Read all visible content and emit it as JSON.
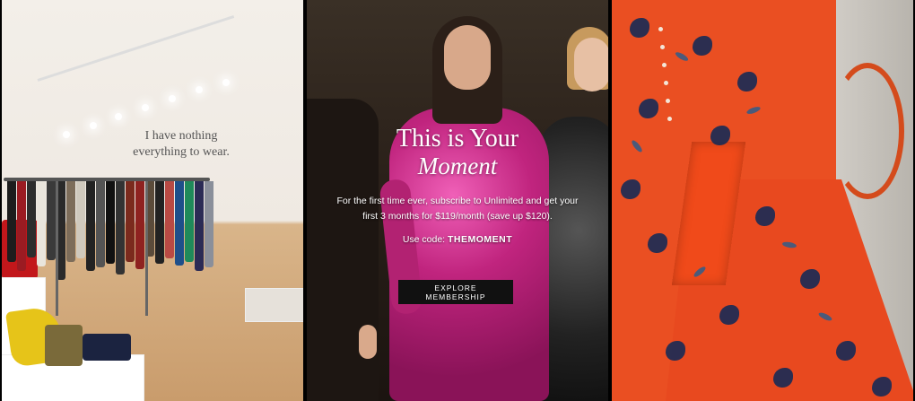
{
  "store_panel": {
    "wall_text": "I have nothing everything to wear."
  },
  "promo": {
    "title": "This is Your",
    "subtitle": "Moment",
    "body": "For the first time ever, subscribe to Unlimited and get your first 3 months for $119/month (save up $120).",
    "code_label": "Use code:",
    "code_value": "THEMOMENT",
    "cta_label": "EXPLORE MEMBERSHIP"
  },
  "colors": {
    "cta_background": "#111111",
    "cta_text": "#ffffff",
    "dress_accent": "#e44a22",
    "sequin_pink": "#c0247e"
  }
}
